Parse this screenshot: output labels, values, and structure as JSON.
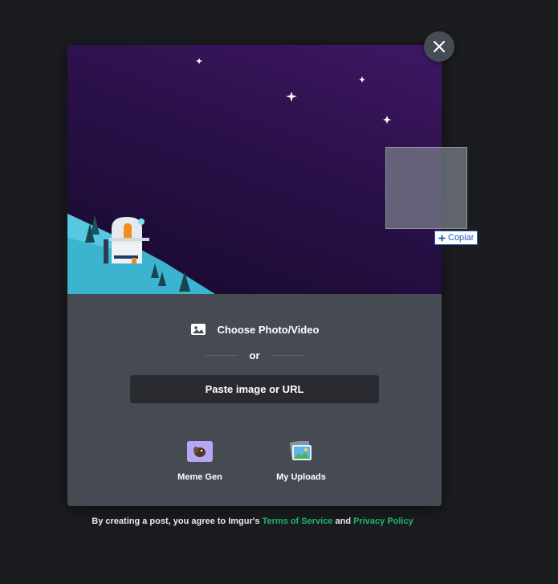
{
  "modal": {
    "choose_label": "Choose Photo/Video",
    "or_label": "or",
    "paste_label": "Paste image or URL",
    "tiles": [
      {
        "label": "Meme Gen",
        "icon": "meme-gen-icon"
      },
      {
        "label": "My Uploads",
        "icon": "my-uploads-icon"
      }
    ]
  },
  "footer": {
    "prefix": "By creating a post, you agree to Imgur's",
    "terms": "Terms of Service",
    "and": "and",
    "privacy": "Privacy Policy"
  },
  "drag": {
    "tooltip": "Copiar"
  },
  "colors": {
    "page_bg": "#1b1c20",
    "modal_bg": "#464b53",
    "link_green": "#1bb76e",
    "sky_purple": "#2a1049"
  }
}
